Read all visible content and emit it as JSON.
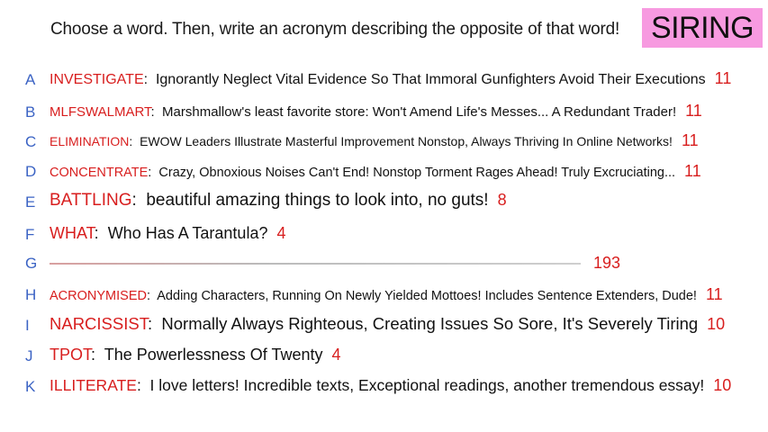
{
  "prompt": "Choose a word. Then, write an acronym describing the opposite of that word!",
  "badge": "SIRING",
  "rows": [
    {
      "letter": "A",
      "word": "INVESTIGATE",
      "text": "Ignorantly Neglect Vital Evidence So That Immoral Gunfighters Avoid Their Executions",
      "score": "11"
    },
    {
      "letter": "B",
      "word": "MLFSWALMART",
      "text": "Marshmallow's least favorite store: Won't Amend Life's Messes... A Redundant Trader!",
      "score": "11"
    },
    {
      "letter": "C",
      "word": "ELIMINATION",
      "text": "EWOW Leaders Illustrate Masterful Improvement Nonstop, Always Thriving In Online Networks!",
      "score": "11"
    },
    {
      "letter": "D",
      "word": "CONCENTRATE",
      "text": "Crazy, Obnoxious Noises Can't End! Nonstop Torment Rages Ahead! Truly Excruciating...",
      "score": "11"
    },
    {
      "letter": "E",
      "word": "BATTLING",
      "text": "beautiful amazing things to look into, no guts!",
      "score": "8"
    },
    {
      "letter": "F",
      "word": "WHAT",
      "text": "Who Has A Tarantula?",
      "score": "4"
    },
    {
      "letter": "G",
      "word": "",
      "text": "",
      "score": "193"
    },
    {
      "letter": "H",
      "word": "ACRONYMISED",
      "text": "Adding Characters, Running On Newly Yielded Mottoes! Includes Sentence Extenders, Dude!",
      "score": "11"
    },
    {
      "letter": "I",
      "word": "NARCISSIST",
      "text": "Normally Always Righteous, Creating Issues So Sore, It's Severely Tiring",
      "score": "10"
    },
    {
      "letter": "J",
      "word": "TPOT",
      "text": "The Powerlessness Of Twenty",
      "score": "4"
    },
    {
      "letter": "K",
      "word": "ILLITERATE",
      "text": "I love letters! Incredible texts, Exceptional readings, another tremendous essay!",
      "score": "10"
    }
  ]
}
